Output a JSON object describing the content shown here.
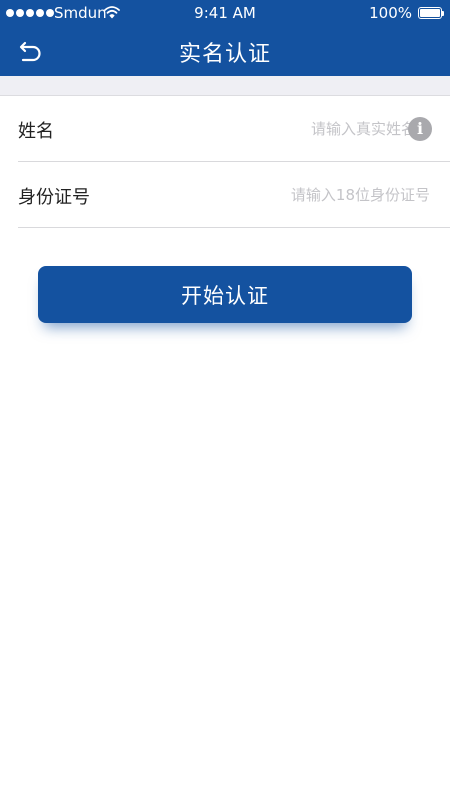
{
  "status_bar": {
    "carrier": "Smdun",
    "time": "9:41 AM",
    "battery_percent": "100%",
    "battery_level": 1.0,
    "signal_dots": 5
  },
  "nav": {
    "title": "实名认证",
    "back_icon": "back-arrow-icon"
  },
  "form": {
    "name": {
      "label": "姓名",
      "placeholder": "请输入真实姓名",
      "value": "",
      "info_icon": "info-icon",
      "info_glyph": "i"
    },
    "id_number": {
      "label": "身份证号",
      "placeholder": "请输入18位身份证号",
      "value": ""
    }
  },
  "actions": {
    "start_button_label": "开始认证"
  },
  "colors": {
    "primary": "#1452a0",
    "page_background": "#ffffff",
    "separator_band": "#efeff4",
    "placeholder": "#c4c4c8",
    "info_icon_bg": "#a9a9ad"
  }
}
